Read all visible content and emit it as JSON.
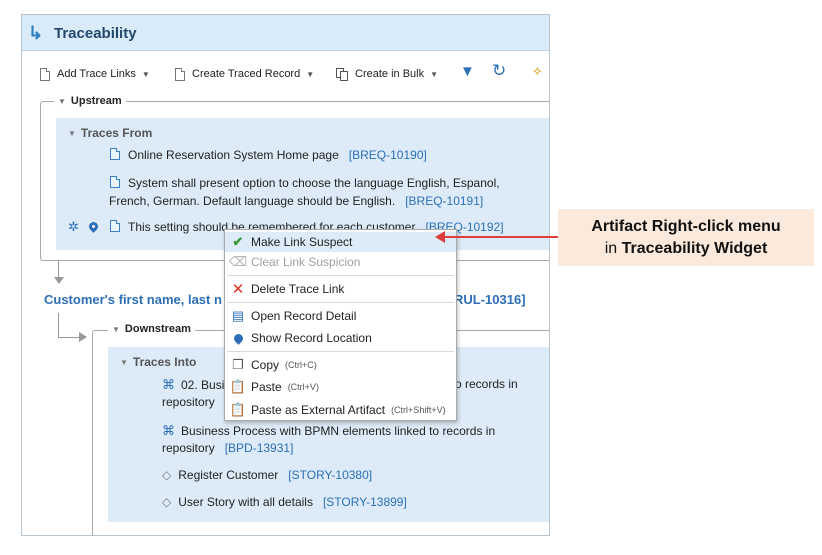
{
  "widget": {
    "title": "Traceability",
    "toolbar": {
      "add_trace_links": "Add Trace Links",
      "create_traced_record": "Create Traced Record",
      "create_in_bulk": "Create in Bulk"
    },
    "upstream": {
      "label": "Upstream",
      "traces_from_label": "Traces From",
      "items": [
        {
          "text": "Online Reservation System Home page",
          "id": "[BREQ-10190]"
        },
        {
          "text_line1": "System shall present option to choose the language English, Espanol,",
          "text_line2": "French, German. Default language should be English.",
          "id": "[BREQ-10191]"
        },
        {
          "text": "This setting should be remembered for each customer",
          "id": "[BREQ-10192]"
        }
      ]
    },
    "record": {
      "title_left": "Customer's first name, last n",
      "title_right": "RUL-10316]"
    },
    "downstream": {
      "label": "Downstream",
      "traces_into_label": "Traces Into",
      "items": [
        {
          "text_line1_left": "02. Busi",
          "text_line1_right": "o records in",
          "text_line2": "repository"
        },
        {
          "text_line1": "Business Process with BPMN elements linked to records in",
          "text_line2": "repository",
          "id": "[BPD-13931]"
        },
        {
          "text": "Register Customer",
          "id": "[STORY-10380]"
        },
        {
          "text": "User Story with all details",
          "id": "[STORY-13899]"
        }
      ]
    }
  },
  "context_menu": {
    "make_link_suspect": "Make Link Suspect",
    "clear_link_suspicion": "Clear Link Suspicion",
    "delete_trace_link": "Delete Trace Link",
    "open_record_detail": "Open Record Detail",
    "show_record_location": "Show Record Location",
    "copy": "Copy",
    "copy_shortcut": "(Ctrl+C)",
    "paste": "Paste",
    "paste_shortcut": "(Ctrl+V)",
    "paste_external": "Paste as External Artifact",
    "paste_external_shortcut": "(Ctrl+Shift+V)"
  },
  "callout": {
    "line1": "Artifact Right-click menu",
    "line2_prefix": "in",
    "line2_bold": "Traceability Widget"
  },
  "colors": {
    "accent": "#2c6fb7",
    "header_bg": "#d9ebf8",
    "panel_bg": "#dcebf7",
    "callout_bg": "#fbe9db",
    "pointer": "#e03c3c"
  }
}
